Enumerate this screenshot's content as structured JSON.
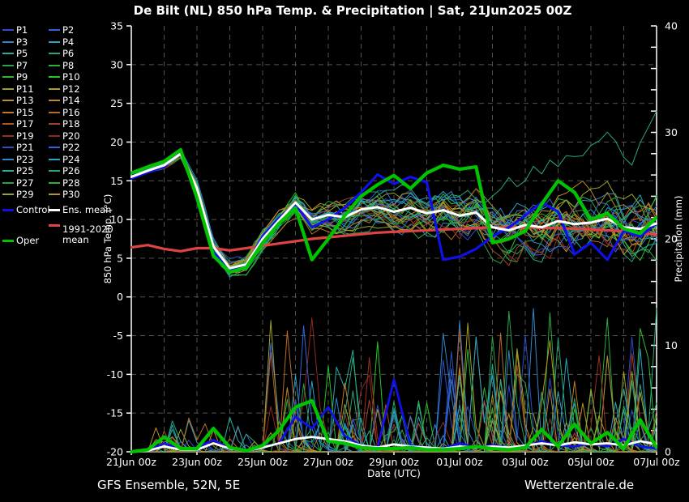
{
  "footer": {
    "model": "GFS Ensemble, 52N, 5E",
    "source": "Wetterzentrale.de"
  },
  "legend": {
    "members": [
      {
        "label": "P1",
        "color": "#2b4fc8"
      },
      {
        "label": "P2",
        "color": "#2f66d8"
      },
      {
        "label": "P3",
        "color": "#2e86cc"
      },
      {
        "label": "P4",
        "color": "#2aa3c4"
      },
      {
        "label": "P5",
        "color": "#28ab9e"
      },
      {
        "label": "P6",
        "color": "#27a878"
      },
      {
        "label": "P7",
        "color": "#27a34c"
      },
      {
        "label": "P8",
        "color": "#2bae3a"
      },
      {
        "label": "P9",
        "color": "#2eb92e"
      },
      {
        "label": "P10",
        "color": "#24c724"
      },
      {
        "label": "P11",
        "color": "#9ba324"
      },
      {
        "label": "P12",
        "color": "#aaa022"
      },
      {
        "label": "P13",
        "color": "#b79522"
      },
      {
        "label": "P14",
        "color": "#bd8a24"
      },
      {
        "label": "P15",
        "color": "#c27a24"
      },
      {
        "label": "P16",
        "color": "#bb6a26"
      },
      {
        "label": "P17",
        "color": "#b05426"
      },
      {
        "label": "P18",
        "color": "#a34127"
      },
      {
        "label": "P19",
        "color": "#9b3124"
      },
      {
        "label": "P20",
        "color": "#8e2a22"
      },
      {
        "label": "P21",
        "color": "#2b4fc8"
      },
      {
        "label": "P22",
        "color": "#2f66d8"
      },
      {
        "label": "P23",
        "color": "#2e86cc"
      },
      {
        "label": "P24",
        "color": "#2aa3c4"
      },
      {
        "label": "P25",
        "color": "#28ab9e"
      },
      {
        "label": "P26",
        "color": "#27a878"
      },
      {
        "label": "P27",
        "color": "#27a34c"
      },
      {
        "label": "P28",
        "color": "#2bae3a"
      },
      {
        "label": "P29",
        "color": "#9ba324"
      },
      {
        "label": "P30",
        "color": "#b79522"
      }
    ],
    "control": {
      "label": "Control",
      "color": "#1010e8"
    },
    "ens_mean": {
      "label": "Ens. mean",
      "color": "#ffffff"
    },
    "clim_mean": {
      "label": "1991-2020 mean",
      "color": "#e04343"
    },
    "oper": {
      "label": "Oper",
      "color": "#00c400"
    }
  },
  "chart_data": {
    "type": "line",
    "title": "De Bilt  (NL)  850 hPa Temp. & Precipitation | Sat, 21Jun2025 00Z",
    "x_axis": {
      "label": "Date (UTC)",
      "tick_labels": [
        "21Jun 00z",
        "23Jun 00z",
        "25Jun 00z",
        "27Jun 00z",
        "29Jun 00z",
        "01Jul 00z",
        "03Jul 00z",
        "05Jul 00z",
        "07Jul 00z"
      ],
      "tick_days": [
        0,
        2,
        4,
        6,
        8,
        10,
        12,
        14,
        16
      ],
      "range_days": [
        0,
        16
      ]
    },
    "y_left": {
      "label": "850 hPa Temp. (°C)",
      "ticks": [
        35,
        30,
        25,
        20,
        15,
        10,
        5,
        0,
        -5,
        -10,
        -15,
        -20
      ],
      "range": [
        -20,
        35
      ]
    },
    "y_right": {
      "label": "Precipitation (mm)",
      "ticks": [
        40,
        30,
        20,
        10,
        0
      ],
      "range": [
        0,
        40
      ],
      "minor_tick_mm": 2
    },
    "grid": {
      "show": true,
      "v_interval_days": 1,
      "h_interval_degC": 5,
      "color": "#55524a"
    },
    "time_step_days": 0.5,
    "series": [
      {
        "name": "1991-2020 mean",
        "kind": "temperature",
        "color": "#e04343",
        "width": 3.2,
        "values": [
          6.4,
          6.7,
          6.2,
          5.9,
          6.3,
          6.3,
          6.0,
          6.3,
          6.6,
          6.9,
          7.2,
          7.5,
          7.7,
          7.9,
          8.1,
          8.3,
          8.4,
          8.5,
          8.6,
          8.7,
          8.8,
          8.9,
          9.0,
          9.0,
          9.0,
          8.9,
          8.9,
          8.8,
          8.7,
          8.6,
          8.5,
          8.3,
          8.0
        ]
      },
      {
        "name": "Control",
        "kind": "temperature",
        "color": "#1010e8",
        "width": 3.2,
        "values": [
          15.3,
          16.1,
          16.8,
          18.8,
          13.3,
          5.8,
          3.4,
          4.0,
          7.8,
          10.2,
          12.0,
          9.0,
          10.0,
          11.5,
          13.5,
          15.8,
          14.6,
          15.5,
          14.8,
          4.8,
          5.2,
          6.2,
          7.8,
          9.0,
          10.5,
          12.2,
          11.0,
          5.5,
          7.0,
          4.8,
          8.5,
          7.8,
          9.5
        ]
      },
      {
        "name": "Ens. mean",
        "kind": "temperature",
        "color": "#ffffff",
        "width": 3,
        "values": [
          15.5,
          16.3,
          17.0,
          18.5,
          14.0,
          6.5,
          3.7,
          4.2,
          7.5,
          9.9,
          12.2,
          10.0,
          10.6,
          10.3,
          11.3,
          11.6,
          11.0,
          11.5,
          10.8,
          11.2,
          10.5,
          10.9,
          9.0,
          8.6,
          9.3,
          9.0,
          9.8,
          9.4,
          9.6,
          10.1,
          9.0,
          8.8,
          9.5
        ]
      },
      {
        "name": "Oper",
        "kind": "temperature",
        "color": "#00c400",
        "width": 4.2,
        "values": [
          16.0,
          16.8,
          17.5,
          19.0,
          12.8,
          5.3,
          3.2,
          3.8,
          7.0,
          9.5,
          11.5,
          4.8,
          7.5,
          10.5,
          13.0,
          14.5,
          15.7,
          14.0,
          16.0,
          17.0,
          16.5,
          16.8,
          7.0,
          7.5,
          8.5,
          12.0,
          15.0,
          13.5,
          10.0,
          10.8,
          8.8,
          8.2,
          10.3
        ]
      },
      {
        "name": "Control precip",
        "kind": "precipitation",
        "color": "#1010e8",
        "width": 2.8,
        "values": [
          0,
          0.1,
          0.8,
          0.2,
          0.4,
          1.1,
          0.3,
          0.1,
          0.4,
          0.8,
          3.3,
          2.2,
          4.2,
          1.5,
          0.6,
          0.4,
          6.8,
          0.6,
          0.4,
          0.3,
          0.8,
          0.4,
          0.6,
          0.4,
          0.5,
          1.0,
          0.6,
          0.5,
          0.8,
          0.5,
          1.2,
          0.5,
          0.3
        ]
      },
      {
        "name": "Ens. mean precip",
        "kind": "precipitation",
        "color": "#ffffff",
        "width": 2.8,
        "values": [
          0,
          0.1,
          0.5,
          0.2,
          0.2,
          0.8,
          0.3,
          0.1,
          0.4,
          0.8,
          1.2,
          1.4,
          1.2,
          1.0,
          0.6,
          0.4,
          0.7,
          0.5,
          0.4,
          0.3,
          0.5,
          0.4,
          0.5,
          0.4,
          0.6,
          0.8,
          0.6,
          0.9,
          0.7,
          0.8,
          0.6,
          1.0,
          0.7
        ]
      },
      {
        "name": "Oper precip",
        "kind": "precipitation",
        "color": "#00c400",
        "width": 4.2,
        "values": [
          0,
          0.2,
          1.4,
          0.3,
          0.3,
          2.2,
          0.4,
          0.1,
          0.6,
          2.0,
          4.2,
          4.8,
          1.0,
          0.8,
          0.4,
          0.3,
          0.3,
          0.4,
          0.2,
          0.2,
          0.3,
          0.5,
          0.3,
          0.2,
          0.4,
          2.1,
          0.5,
          2.6,
          0.8,
          1.8,
          0.3,
          3.0,
          0.4
        ]
      }
    ],
    "ensemble": {
      "count": 30,
      "line_width": 1,
      "temp_spread_note": "members hug the mean (±0.5°C) through 23Jun then fan out to roughly 3–18°C by 07Jul",
      "outlier": {
        "member_index": 25,
        "start_day": 10,
        "rate_deg_per_day": 2.1,
        "max_boost": 13,
        "peak_degC": 23
      },
      "precip_spike_max_mm": 14
    }
  }
}
